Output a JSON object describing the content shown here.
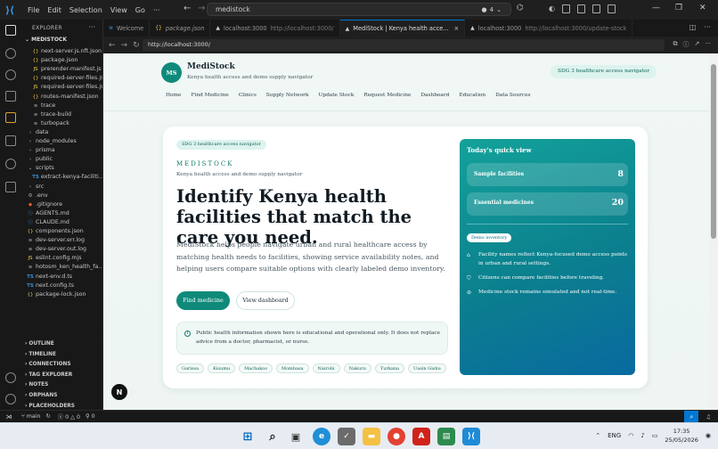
{
  "titlebar": {
    "menus": [
      "File",
      "Edit",
      "Selection",
      "View",
      "Go"
    ],
    "search": "medistock",
    "agent_count": "4"
  },
  "sidebar": {
    "title": "EXPLORER",
    "root": "MEDISTOCK",
    "items": [
      {
        "name": "next-server.js.nft.json",
        "glyph": "{}",
        "type": "json",
        "indent": 2
      },
      {
        "name": "package.json",
        "glyph": "{}",
        "type": "json",
        "indent": 2
      },
      {
        "name": "prerender-manifest.js",
        "glyph": "JS",
        "type": "js",
        "indent": 2
      },
      {
        "name": "required-server-files.js",
        "glyph": "{}",
        "type": "json",
        "indent": 2
      },
      {
        "name": "required-server-files.js",
        "glyph": "JS",
        "type": "js",
        "indent": 2
      },
      {
        "name": "routes-manifest.json",
        "glyph": "{}",
        "type": "json",
        "indent": 2
      },
      {
        "name": "trace",
        "glyph": "≡",
        "type": "log",
        "indent": 2
      },
      {
        "name": "trace-build",
        "glyph": "≡",
        "type": "log",
        "indent": 2
      },
      {
        "name": "turbopack",
        "glyph": "≡",
        "type": "log",
        "indent": 2
      },
      {
        "name": "data",
        "glyph": "›",
        "type": "fold",
        "indent": 1
      },
      {
        "name": "node_modules",
        "glyph": "›",
        "type": "fold",
        "indent": 1
      },
      {
        "name": "prisma",
        "glyph": "›",
        "type": "fold",
        "indent": 1
      },
      {
        "name": "public",
        "glyph": "›",
        "type": "fold",
        "indent": 1
      },
      {
        "name": "scripts",
        "glyph": "⌄",
        "type": "fold",
        "indent": 1
      },
      {
        "name": "extract-kenya-faciliti...",
        "glyph": "TS",
        "type": "ts",
        "indent": 2
      },
      {
        "name": "src",
        "glyph": "›",
        "type": "fold",
        "indent": 1
      },
      {
        "name": ".env",
        "glyph": "⚙",
        "type": "env",
        "indent": 1
      },
      {
        "name": ".gitignore",
        "glyph": "◆",
        "type": "git",
        "indent": 1
      },
      {
        "name": "AGENTS.md",
        "glyph": "ⓘ",
        "type": "md",
        "indent": 1
      },
      {
        "name": "CLAUDE.md",
        "glyph": "ⓘ",
        "type": "md",
        "indent": 1
      },
      {
        "name": "components.json",
        "glyph": "{}",
        "type": "json",
        "indent": 1
      },
      {
        "name": "dev-server.err.log",
        "glyph": "≡",
        "type": "log",
        "indent": 1
      },
      {
        "name": "dev-server.out.log",
        "glyph": "≡",
        "type": "log",
        "indent": 1
      },
      {
        "name": "eslint.config.mjs",
        "glyph": "JS",
        "type": "mjs",
        "indent": 1
      },
      {
        "name": "hotosm_ken_health_fa...",
        "glyph": "≡",
        "type": "log",
        "indent": 1
      },
      {
        "name": "next-env.d.ts",
        "glyph": "TS",
        "type": "ts",
        "indent": 1
      },
      {
        "name": "next.config.ts",
        "glyph": "TS",
        "type": "ts",
        "indent": 1
      },
      {
        "name": "package-lock.json",
        "glyph": "{}",
        "type": "json",
        "indent": 1
      }
    ],
    "sections": [
      "OUTLINE",
      "TIMELINE",
      "CONNECTIONS",
      "TAG EXPLORER",
      "NOTES",
      "ORPHANS",
      "PLACEHOLDERS"
    ]
  },
  "tabs": [
    {
      "label": "Welcome",
      "sub": "",
      "icon": "≋",
      "active": false
    },
    {
      "label": "package.json",
      "sub": "",
      "icon": "{}",
      "active": false
    },
    {
      "label": "localhost:3000",
      "sub": "http://localhost:3000/",
      "icon": "▲",
      "active": false
    },
    {
      "label": "MediStock | Kenya health acce...",
      "sub": "",
      "icon": "▲",
      "active": true,
      "close": "×"
    },
    {
      "label": "localhost:3000",
      "sub": "http://localhost:3000/update-stock",
      "icon": "▲",
      "active": false
    }
  ],
  "browser": {
    "url": "http://localhost:3000/"
  },
  "site": {
    "logo": "MS",
    "name": "MediStock",
    "tagline": "Kenya health access and demo supply navigator",
    "sdg": "SDG 3 healthcare access navigator",
    "nav": [
      "Home",
      "Find Medicine",
      "Clinics",
      "Supply Network",
      "Update Stock",
      "Request Medicine",
      "Dashboard",
      "Education",
      "Data Sources"
    ]
  },
  "hero": {
    "pill": "SDG 3 healthcare access navigator",
    "brand": "MEDISTOCK",
    "brand_sub": "Kenya health access and demo supply navigator",
    "headline": "Identify Kenya health facilities that match the care you need.",
    "lead": "MediStock helps people navigate urban and rural healthcare access by matching health needs to facilities, showing service availability notes, and helping users compare suitable options with clearly labeled demo inventory.",
    "primary_btn": "Find medicine",
    "secondary_btn": "View dashboard",
    "notice": "Public health information shown here is educational and operational only. It does not replace advice from a doctor, pharmacist, or nurse.",
    "towns": [
      "Garissa",
      "Kisumu",
      "Machakos",
      "Mombasa",
      "Nairobi",
      "Nakuru",
      "Turkana",
      "Uasin Gishu"
    ]
  },
  "quick_view": {
    "title": "Today's quick view",
    "stats": [
      {
        "label": "Sample facilities",
        "value": "8"
      },
      {
        "label": "Essential medicines",
        "value": "20"
      }
    ],
    "demo_pill": "Demo inventory",
    "items": [
      {
        "icon": "⌂",
        "text": "Facility names reflect Kenya-focused demo access points in urban and rural settings."
      },
      {
        "icon": "⛉",
        "text": "Citizens can compare facilities before traveling."
      },
      {
        "icon": "⊘",
        "text": "Medicine stock remains simulated and not real-time."
      }
    ]
  },
  "statusbar": {
    "branch": "main",
    "sync": "↻",
    "errors": "0",
    "warnings": "0",
    "ports": "0"
  },
  "taskbar": {
    "lang": "ENG",
    "time": "17:35",
    "date": "25/05/2026"
  },
  "colors": {
    "accent": "#0f8a7a",
    "vscode_blue": "#0078d4",
    "quick_gradient_start": "#13a29a",
    "quick_gradient_end": "#0a6aa0"
  }
}
